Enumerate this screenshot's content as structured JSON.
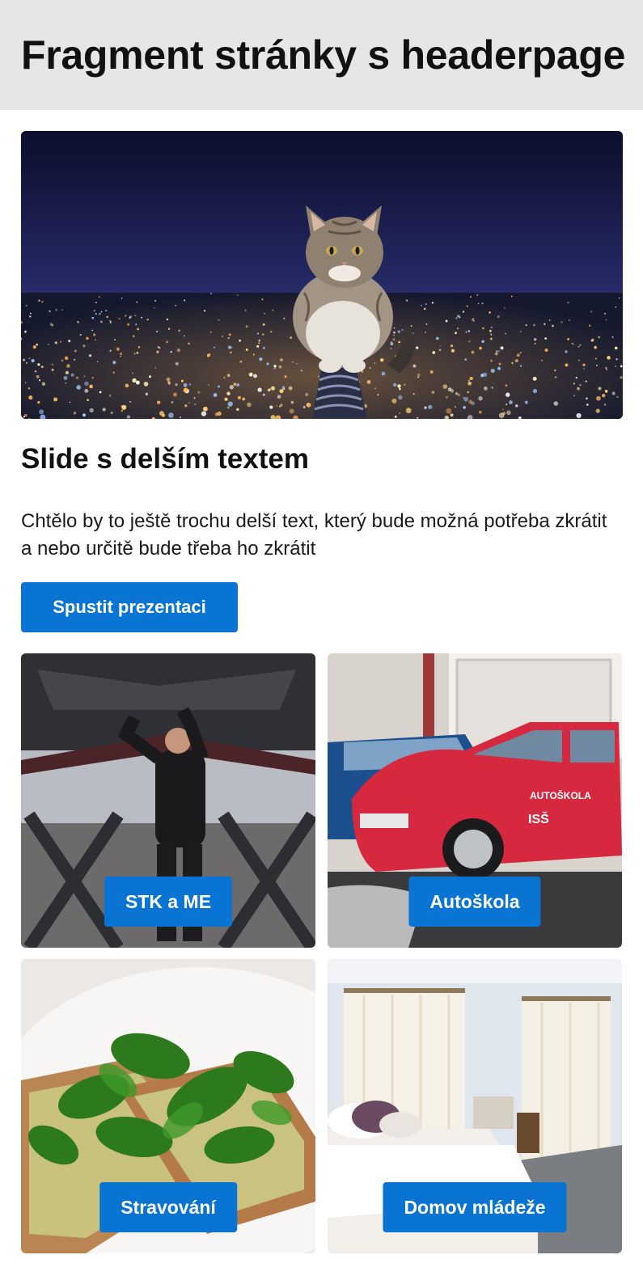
{
  "header": {
    "title": "Fragment stránky s headerpage"
  },
  "hero": {
    "image": "cat-on-spring-over-night-city-photo"
  },
  "slide": {
    "title": "Slide s delším textem",
    "text": "Chtělo by to ještě trochu delší text, který bude možná potřeba zkrátit a nebo určitě bude třeba ho zkrátit",
    "button_label": "Spustit prezentaci"
  },
  "tiles": [
    {
      "label": "STK a ME",
      "image": "mechanic-under-car-photo"
    },
    {
      "label": "Autoškola",
      "image": "red-driving-school-car-photo"
    },
    {
      "label": "Stravování",
      "image": "spinach-avocado-toast-photo"
    },
    {
      "label": "Domov mládeže",
      "image": "bright-bedroom-photo"
    }
  ],
  "car_badge": {
    "line1": "AUTOŠKOLA",
    "line2": "ISŠ"
  },
  "colors": {
    "accent": "#0a74d2",
    "header_bg": "#e6e6e6"
  }
}
